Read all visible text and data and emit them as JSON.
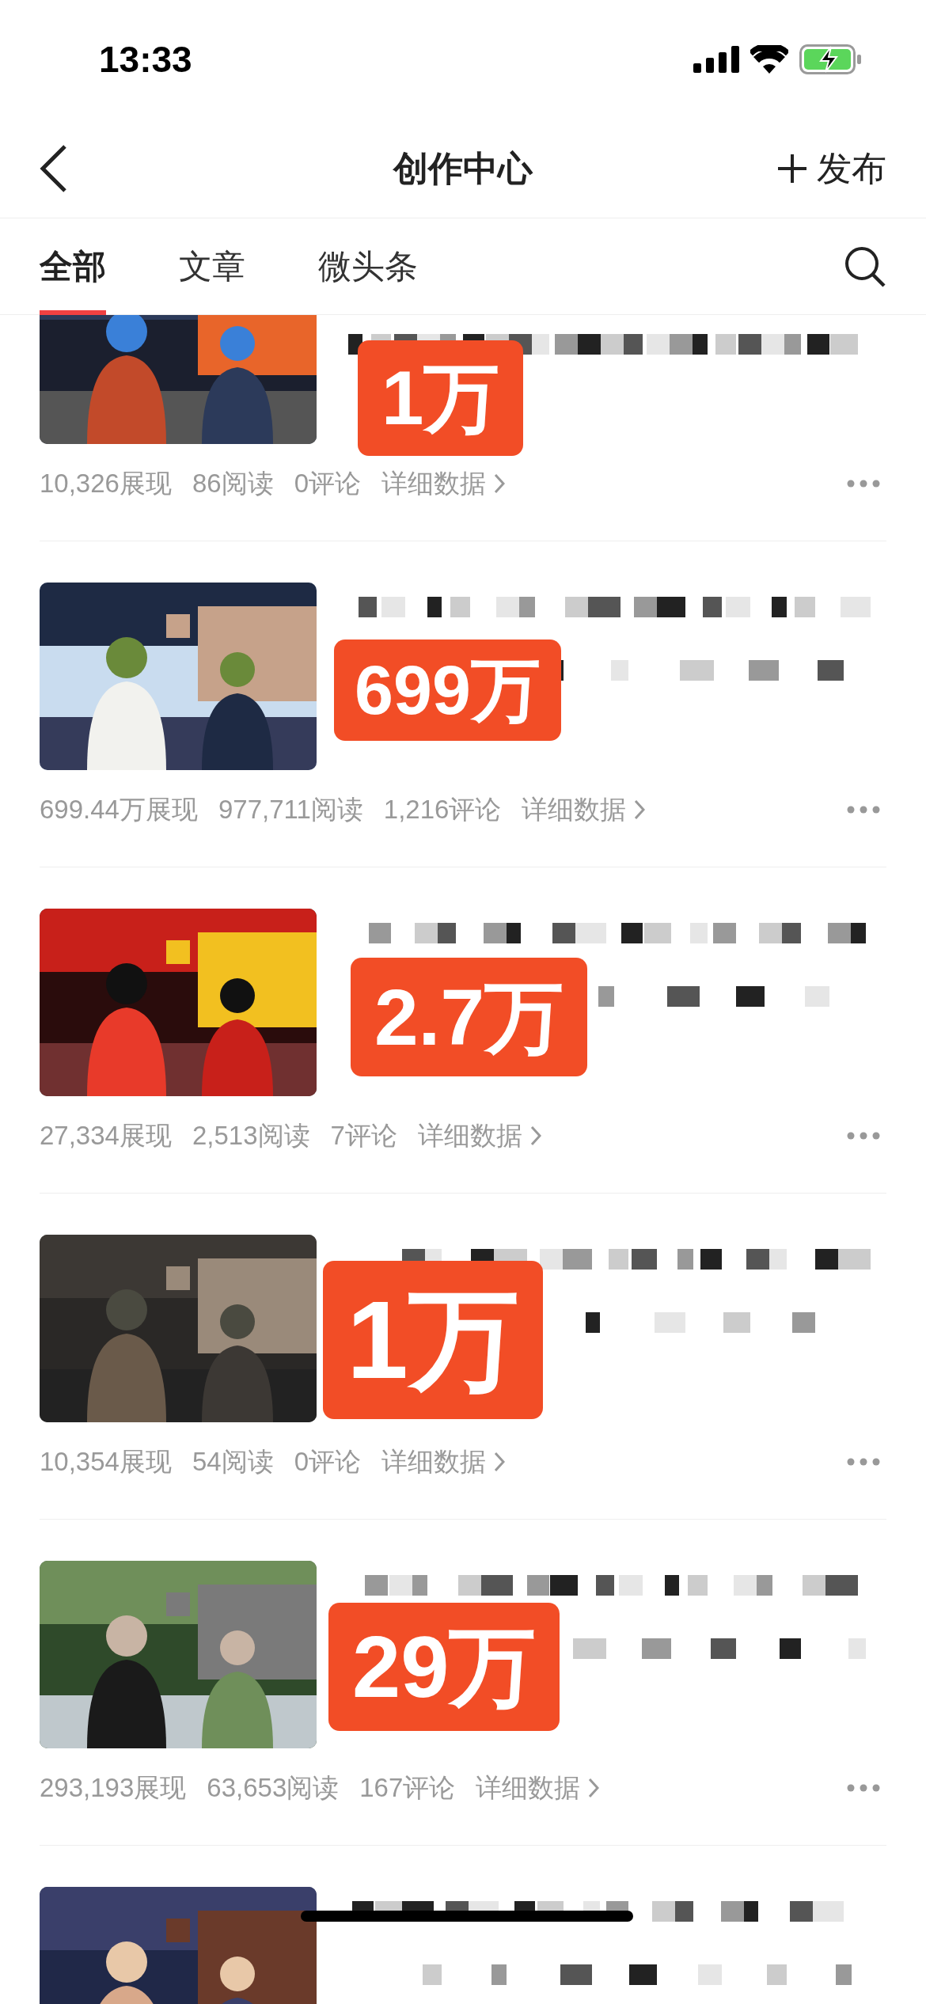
{
  "status_bar": {
    "time": "13:33"
  },
  "header": {
    "title": "创作中心",
    "action": "发布"
  },
  "tabs": [
    {
      "label": "全部",
      "selected": true
    },
    {
      "label": "文章",
      "selected": false
    },
    {
      "label": "微头条",
      "selected": false
    }
  ],
  "items": [
    {
      "badge": "1万",
      "views": "10,326展现",
      "reads": "86阅读",
      "comments": "0评论",
      "details": "详细数据"
    },
    {
      "badge": "699万",
      "views": "699.44万展现",
      "reads": "977,711阅读",
      "comments": "1,216评论",
      "details": "详细数据"
    },
    {
      "badge": "2.7万",
      "views": "27,334展现",
      "reads": "2,513阅读",
      "comments": "7评论",
      "details": "详细数据"
    },
    {
      "badge": "1万",
      "views": "10,354展现",
      "reads": "54阅读",
      "comments": "0评论",
      "details": "详细数据"
    },
    {
      "badge": "29万",
      "views": "293,193展现",
      "reads": "63,653阅读",
      "comments": "167评论",
      "details": "详细数据"
    },
    {
      "kind": "picture"
    }
  ]
}
